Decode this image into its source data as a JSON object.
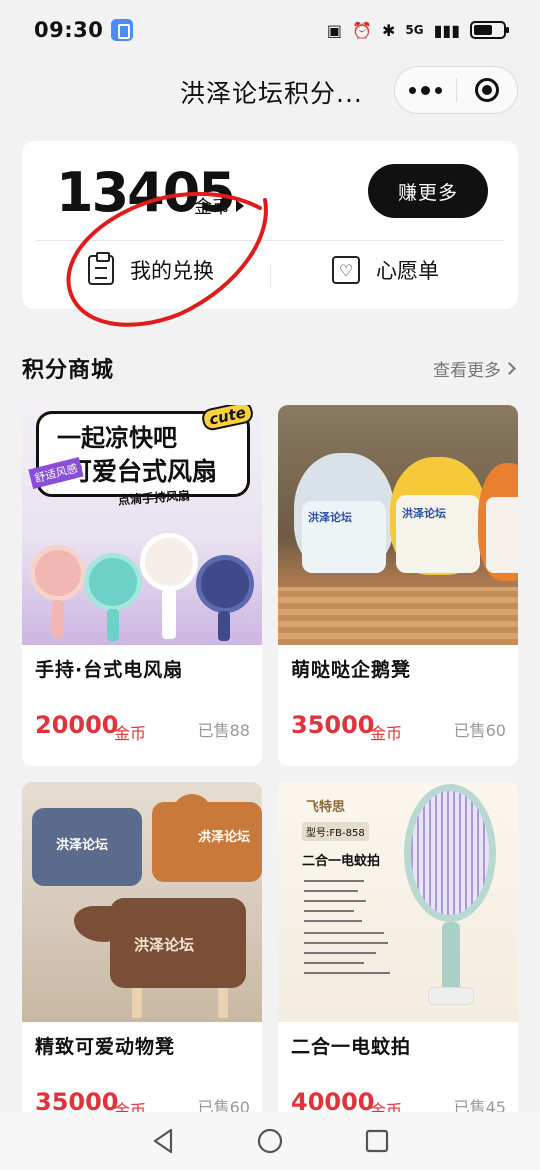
{
  "status_bar": {
    "time": "09:30",
    "network": "5G"
  },
  "nav": {
    "title": "洪泽论坛积分...",
    "more_icon": "more-dots-icon",
    "close_icon": "target-ring-icon"
  },
  "points": {
    "value": "13405",
    "unit": "金币",
    "earn_label": "赚更多",
    "exchange_label": "我的兑换",
    "wishlist_label": "心愿单"
  },
  "section": {
    "title": "积分商城",
    "view_more": "查看更多"
  },
  "products": [
    {
      "name": "手持·台式电风扇",
      "price": "20000",
      "unit": "金币",
      "sold": "已售88"
    },
    {
      "name": "萌哒哒企鹅凳",
      "price": "35000",
      "unit": "金币",
      "sold": "已售60"
    },
    {
      "name": "精致可爱动物凳",
      "price": "35000",
      "unit": "金币",
      "sold": "已售60"
    },
    {
      "name": "二合一电蚊拍",
      "price": "40000",
      "unit": "金币",
      "sold": "已售45"
    }
  ],
  "product_images": {
    "fan": {
      "line1": "一起凉快吧",
      "line2": "可爱台式风扇",
      "tag": "cute",
      "badge": "舒适风感",
      "caption": "点滴手持风扇"
    },
    "penguin": {
      "label": "洪泽论坛"
    },
    "stool": {
      "label": "洪泽论坛"
    },
    "racket": {
      "brand": "飞特思",
      "model": "型号:FB-858",
      "heading": "二合一电蚊拍"
    }
  },
  "colors": {
    "accent": "#e0333b",
    "dark_button": "#111111",
    "annotation_red": "#e01b1b"
  }
}
